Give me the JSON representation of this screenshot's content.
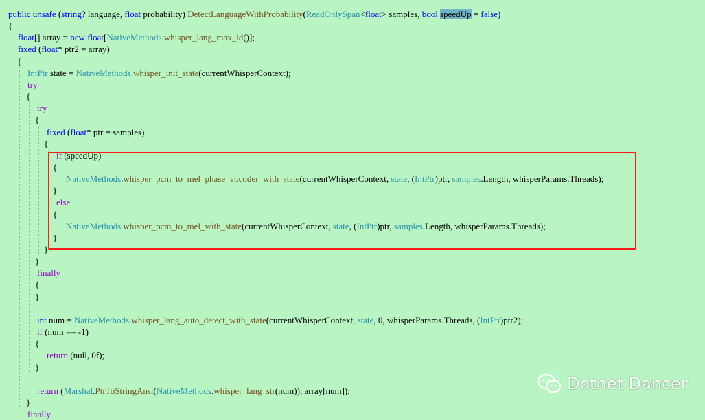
{
  "code_lines": [
    {
      "tokens": [
        {
          "t": "public unsafe ",
          "c": "kw"
        },
        {
          "t": "(",
          "c": ""
        },
        {
          "t": "string",
          "c": "kw"
        },
        {
          "t": "? language, ",
          "c": ""
        },
        {
          "t": "float",
          "c": "kw"
        },
        {
          "t": " probability) ",
          "c": ""
        },
        {
          "t": "DetectLanguageWithProbability",
          "c": "mt"
        },
        {
          "t": "(",
          "c": ""
        },
        {
          "t": "ReadOnlySpan",
          "c": "ty"
        },
        {
          "t": "<",
          "c": ""
        },
        {
          "t": "float",
          "c": "kw"
        },
        {
          "t": "> samples, ",
          "c": ""
        },
        {
          "t": "bool",
          "c": "kw"
        },
        {
          "t": " ",
          "c": ""
        },
        {
          "t": "speedUp",
          "c": "sel"
        },
        {
          "t": " = ",
          "c": ""
        },
        {
          "t": "false",
          "c": "kw"
        },
        {
          "t": ")",
          "c": ""
        }
      ]
    },
    {
      "tokens": [
        {
          "t": "{",
          "c": ""
        }
      ]
    },
    {
      "tokens": [
        {
          "t": "    ",
          "c": ""
        },
        {
          "t": "float",
          "c": "kw"
        },
        {
          "t": "[] array = ",
          "c": ""
        },
        {
          "t": "new",
          "c": "kw"
        },
        {
          "t": " ",
          "c": ""
        },
        {
          "t": "float",
          "c": "kw"
        },
        {
          "t": "[",
          "c": ""
        },
        {
          "t": "NativeMethods",
          "c": "ty"
        },
        {
          "t": ".",
          "c": ""
        },
        {
          "t": "whisper_lang_max_id",
          "c": "mt"
        },
        {
          "t": "()];",
          "c": ""
        }
      ]
    },
    {
      "tokens": [
        {
          "t": "    ",
          "c": ""
        },
        {
          "t": "fixed",
          "c": "kw"
        },
        {
          "t": " (",
          "c": ""
        },
        {
          "t": "float",
          "c": "kw"
        },
        {
          "t": "* ptr2 = array)",
          "c": ""
        }
      ]
    },
    {
      "tokens": [
        {
          "t": "    {",
          "c": ""
        }
      ]
    },
    {
      "tokens": [
        {
          "t": "        ",
          "c": ""
        },
        {
          "t": "IntPtr",
          "c": "ty"
        },
        {
          "t": " state = ",
          "c": ""
        },
        {
          "t": "NativeMethods",
          "c": "ty"
        },
        {
          "t": ".",
          "c": ""
        },
        {
          "t": "whisper_init_state",
          "c": "mt"
        },
        {
          "t": "(currentWhisperContext);",
          "c": ""
        }
      ]
    },
    {
      "tokens": [
        {
          "t": "        ",
          "c": ""
        },
        {
          "t": "try",
          "c": "ct"
        }
      ]
    },
    {
      "tokens": [
        {
          "t": "        {",
          "c": ""
        }
      ]
    },
    {
      "tokens": [
        {
          "t": "            ",
          "c": ""
        },
        {
          "t": "try",
          "c": "ct"
        }
      ]
    },
    {
      "tokens": [
        {
          "t": "            {",
          "c": ""
        }
      ]
    },
    {
      "tokens": [
        {
          "t": "                ",
          "c": ""
        },
        {
          "t": "fixed",
          "c": "kw"
        },
        {
          "t": " (",
          "c": ""
        },
        {
          "t": "float",
          "c": "kw"
        },
        {
          "t": "* ptr = samples)",
          "c": ""
        }
      ]
    },
    {
      "tokens": [
        {
          "t": "                {",
          "c": ""
        }
      ]
    },
    {
      "tokens": [
        {
          "t": "                    ",
          "c": ""
        },
        {
          "t": "if",
          "c": "ct"
        },
        {
          "t": " (speedUp)",
          "c": ""
        }
      ]
    },
    {
      "tokens": [
        {
          "t": "                    {",
          "c": ""
        }
      ]
    },
    {
      "tokens": [
        {
          "t": "                        ",
          "c": ""
        },
        {
          "t": "NativeMethods",
          "c": "ty"
        },
        {
          "t": ".",
          "c": ""
        },
        {
          "t": "whisper_pcm_to_mel_phase_vocoder_with_state",
          "c": "mt"
        },
        {
          "t": "(currentWhisperContext, ",
          "c": ""
        },
        {
          "t": "state",
          "c": "ty"
        },
        {
          "t": ", (",
          "c": ""
        },
        {
          "t": "IntPtr",
          "c": "ty"
        },
        {
          "t": ")ptr, ",
          "c": ""
        },
        {
          "t": "samples",
          "c": "ty"
        },
        {
          "t": ".Length, whisperParams.Threads);",
          "c": ""
        }
      ]
    },
    {
      "tokens": [
        {
          "t": "                    }",
          "c": ""
        }
      ]
    },
    {
      "tokens": [
        {
          "t": "                    ",
          "c": ""
        },
        {
          "t": "else",
          "c": "ct"
        }
      ]
    },
    {
      "tokens": [
        {
          "t": "                    {",
          "c": ""
        }
      ]
    },
    {
      "tokens": [
        {
          "t": "                        ",
          "c": ""
        },
        {
          "t": "NativeMethods",
          "c": "ty"
        },
        {
          "t": ".",
          "c": ""
        },
        {
          "t": "whisper_pcm_to_mel_with_state",
          "c": "mt"
        },
        {
          "t": "(currentWhisperContext, ",
          "c": ""
        },
        {
          "t": "state",
          "c": "ty"
        },
        {
          "t": ", (",
          "c": ""
        },
        {
          "t": "IntPtr",
          "c": "ty"
        },
        {
          "t": ")ptr, ",
          "c": ""
        },
        {
          "t": "samples",
          "c": "ty"
        },
        {
          "t": ".Length, whisperParams.Threads);",
          "c": ""
        }
      ]
    },
    {
      "tokens": [
        {
          "t": "                    }",
          "c": ""
        }
      ]
    },
    {
      "tokens": [
        {
          "t": "                }",
          "c": ""
        }
      ]
    },
    {
      "tokens": [
        {
          "t": "            }",
          "c": ""
        }
      ]
    },
    {
      "tokens": [
        {
          "t": "            ",
          "c": ""
        },
        {
          "t": "finally",
          "c": "ct"
        }
      ]
    },
    {
      "tokens": [
        {
          "t": "            {",
          "c": ""
        }
      ]
    },
    {
      "tokens": [
        {
          "t": "            }",
          "c": ""
        }
      ]
    },
    {
      "tokens": []
    },
    {
      "tokens": [
        {
          "t": "            ",
          "c": ""
        },
        {
          "t": "int",
          "c": "kw"
        },
        {
          "t": " num = ",
          "c": ""
        },
        {
          "t": "NativeMethods",
          "c": "ty"
        },
        {
          "t": ".",
          "c": ""
        },
        {
          "t": "whisper_lang_auto_detect_with_state",
          "c": "mt"
        },
        {
          "t": "(currentWhisperContext, ",
          "c": ""
        },
        {
          "t": "state",
          "c": "ty"
        },
        {
          "t": ", 0, whisperParams.Threads, (",
          "c": ""
        },
        {
          "t": "IntPtr",
          "c": "ty"
        },
        {
          "t": ")ptr2);",
          "c": ""
        }
      ]
    },
    {
      "tokens": [
        {
          "t": "            ",
          "c": ""
        },
        {
          "t": "if",
          "c": "ct"
        },
        {
          "t": " (num == -1)",
          "c": ""
        }
      ]
    },
    {
      "tokens": [
        {
          "t": "            {",
          "c": ""
        }
      ]
    },
    {
      "tokens": [
        {
          "t": "                ",
          "c": ""
        },
        {
          "t": "return",
          "c": "ct"
        },
        {
          "t": " (null, 0f);",
          "c": ""
        }
      ]
    },
    {
      "tokens": [
        {
          "t": "            }",
          "c": ""
        }
      ]
    },
    {
      "tokens": []
    },
    {
      "tokens": [
        {
          "t": "            ",
          "c": ""
        },
        {
          "t": "return",
          "c": "ct"
        },
        {
          "t": " (",
          "c": ""
        },
        {
          "t": "Marshal",
          "c": "ty"
        },
        {
          "t": ".",
          "c": ""
        },
        {
          "t": "PtrToStringAnsi",
          "c": "mt"
        },
        {
          "t": "(",
          "c": ""
        },
        {
          "t": "NativeMethods",
          "c": "ty"
        },
        {
          "t": ".",
          "c": ""
        },
        {
          "t": "whisper_lang_str",
          "c": "mt"
        },
        {
          "t": "(num)), array[num]);",
          "c": ""
        }
      ]
    },
    {
      "tokens": [
        {
          "t": "        }",
          "c": ""
        }
      ]
    },
    {
      "tokens": [
        {
          "t": "        ",
          "c": ""
        },
        {
          "t": "finally",
          "c": "ct"
        }
      ]
    }
  ],
  "watermark": {
    "text": "Dotnet Dancer",
    "icon": "wechat-icon"
  },
  "colors": {
    "background": "#b9f5c3",
    "keyword": "#0000ff",
    "type": "#2b91af",
    "method": "#74531f",
    "control": "#8f08c4",
    "selection": "#6fb4c8",
    "highlight_box": "#ff1a1a"
  }
}
